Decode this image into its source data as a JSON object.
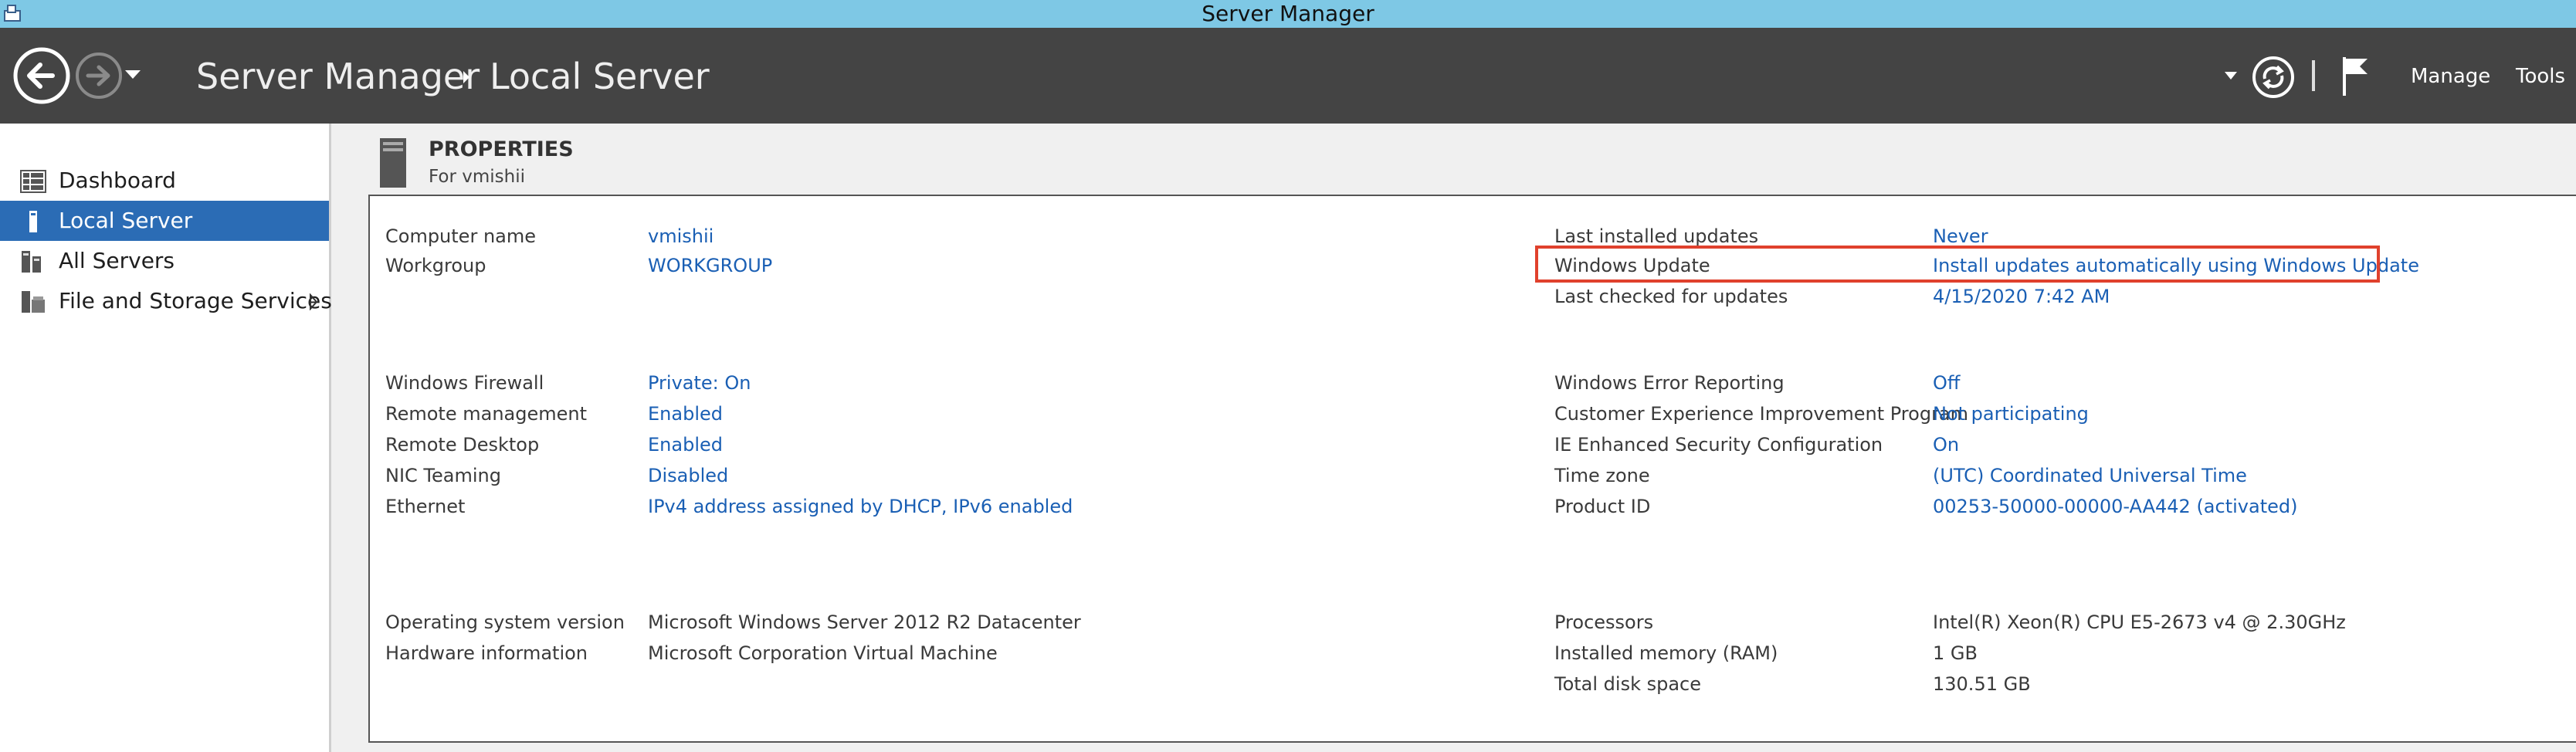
{
  "window": {
    "title": "Server Manager"
  },
  "header": {
    "breadcrumb_root": "Server Manager",
    "breadcrumb_current": "Local Server",
    "menu_manage": "Manage",
    "menu_tools": "Tools"
  },
  "sidebar": {
    "items": [
      {
        "label": "Dashboard",
        "icon": "dashboard-icon"
      },
      {
        "label": "Local Server",
        "icon": "server-icon"
      },
      {
        "label": "All Servers",
        "icon": "servers-icon"
      },
      {
        "label": "File and Storage Services",
        "icon": "storage-icon"
      }
    ]
  },
  "properties": {
    "title": "PROPERTIES",
    "subtitle": "For vmishii",
    "left": {
      "computer_name": {
        "label": "Computer name",
        "value": "vmishii"
      },
      "workgroup": {
        "label": "Workgroup",
        "value": "WORKGROUP"
      },
      "windows_firewall": {
        "label": "Windows Firewall",
        "value": "Private: On"
      },
      "remote_management": {
        "label": "Remote management",
        "value": "Enabled"
      },
      "remote_desktop": {
        "label": "Remote Desktop",
        "value": "Enabled"
      },
      "nic_teaming": {
        "label": "NIC Teaming",
        "value": "Disabled"
      },
      "ethernet": {
        "label": "Ethernet",
        "value": "IPv4 address assigned by DHCP, IPv6 enabled"
      },
      "os_version": {
        "label": "Operating system version",
        "value": "Microsoft Windows Server 2012 R2 Datacenter"
      },
      "hardware_info": {
        "label": "Hardware information",
        "value": "Microsoft Corporation Virtual Machine"
      }
    },
    "right": {
      "last_installed": {
        "label": "Last installed updates",
        "value": "Never"
      },
      "windows_update": {
        "label": "Windows Update",
        "value": "Install updates automatically using Windows Update"
      },
      "last_checked": {
        "label": "Last checked for updates",
        "value": "4/15/2020 7:42 AM"
      },
      "error_reporting": {
        "label": "Windows Error Reporting",
        "value": "Off"
      },
      "ceip": {
        "label": "Customer Experience Improvement Program",
        "value": "Not participating"
      },
      "ie_esc": {
        "label": "IE Enhanced Security Configuration",
        "value": "On"
      },
      "time_zone": {
        "label": "Time zone",
        "value": "(UTC) Coordinated Universal Time"
      },
      "product_id": {
        "label": "Product ID",
        "value": "00253-50000-00000-AA442 (activated)"
      },
      "processors": {
        "label": "Processors",
        "value": "Intel(R) Xeon(R) CPU E5-2673 v4 @ 2.30GHz"
      },
      "memory": {
        "label": "Installed memory (RAM)",
        "value": "1 GB"
      },
      "disk": {
        "label": "Total disk space",
        "value": "130.51 GB"
      }
    }
  },
  "colors": {
    "titlebar": "#7ec8e5",
    "header": "#444444",
    "active_nav": "#2b6cb5",
    "link": "#1a5fb4",
    "highlight_box": "#e0412d"
  }
}
